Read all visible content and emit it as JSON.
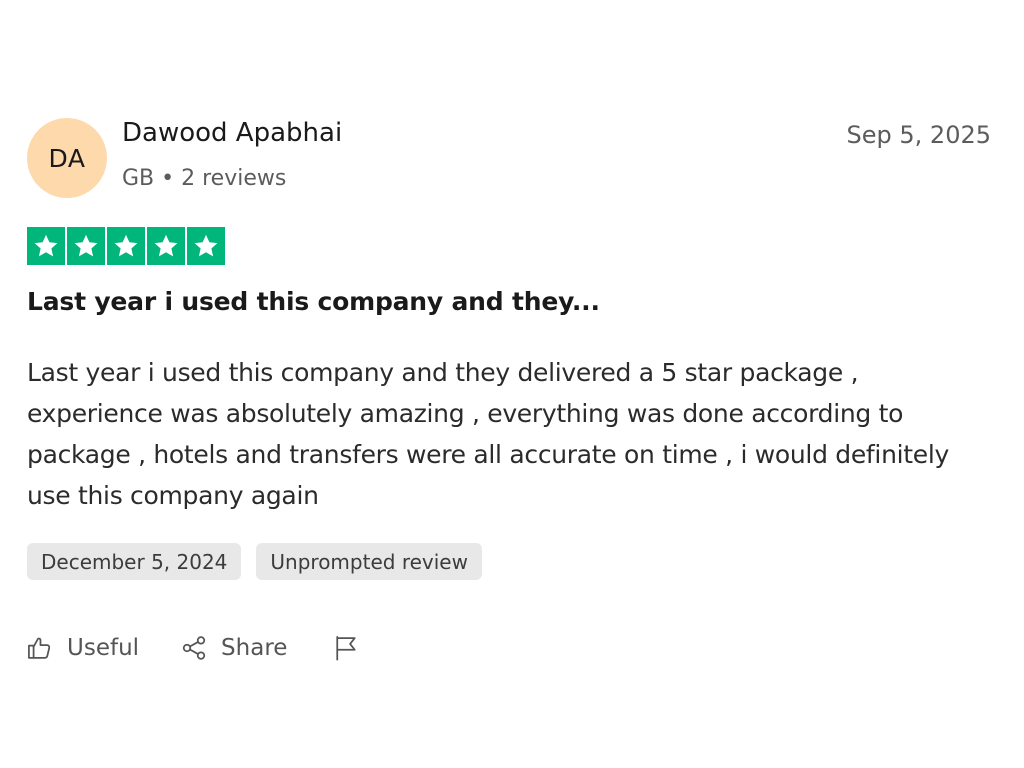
{
  "reviewer": {
    "initials": "DA",
    "name": "Dawood Apabhai",
    "meta": "GB • 2 reviews",
    "avatar_color": "#fdd9ab"
  },
  "review": {
    "date": "Sep 5, 2025",
    "rating": 5,
    "max_rating": 5,
    "star_color": "#00b67a",
    "title": "Last year i used this company and they...",
    "body": "Last year i used this company and they delivered a 5 star package , experience was absolutely amazing , everything was done according to package , hotels and transfers were all accurate on time , i would definitely use this company again"
  },
  "tags": {
    "experience_date": "December 5, 2024",
    "review_type": "Unprompted review"
  },
  "actions": {
    "useful_label": "Useful",
    "useful_icon": "thumbs-up-icon",
    "share_label": "Share",
    "share_icon": "share-icon",
    "report_icon": "flag-icon"
  }
}
